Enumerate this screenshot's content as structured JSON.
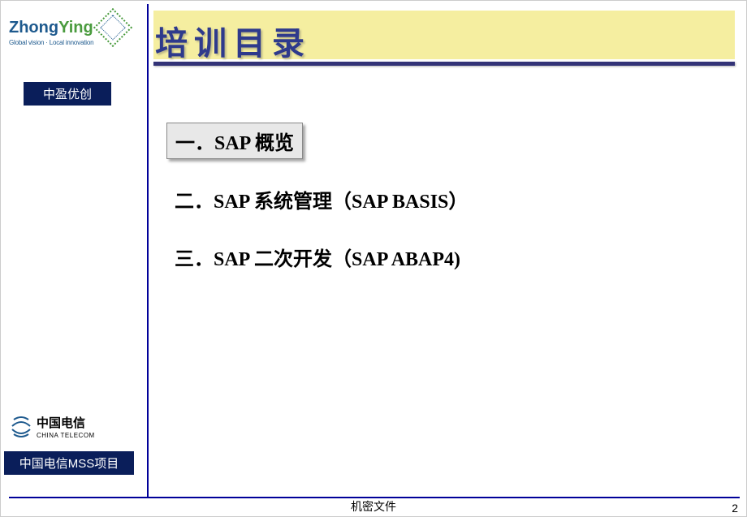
{
  "header": {
    "logo_main": "ZhongYing",
    "logo_tagline": "Global vision · Local innovation",
    "company_badge": "中盈优创"
  },
  "title": "培训目录",
  "toc": [
    {
      "label": "一．SAP 概览",
      "active": true
    },
    {
      "label": "二．SAP 系统管理（SAP BASIS）",
      "active": false
    },
    {
      "label": "三．SAP 二次开发（SAP ABAP4)",
      "active": false
    }
  ],
  "footer": {
    "telecom_name": "中国电信",
    "telecom_sub": "CHINA TELECOM",
    "project_badge": "中国电信MSS项目",
    "confidential": "机密文件",
    "page": "2"
  }
}
